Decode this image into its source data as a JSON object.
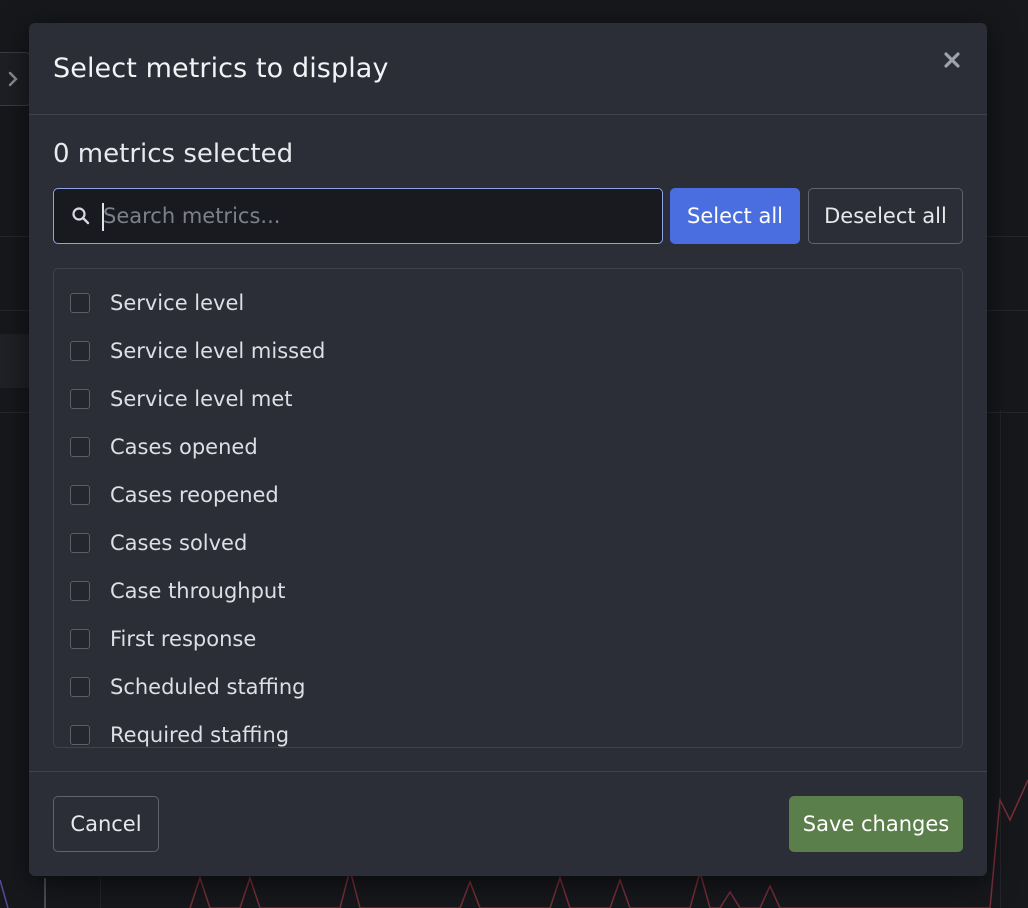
{
  "modal": {
    "title": "Select metrics to display",
    "close_icon": "close-icon",
    "selected_count_label": "0 metrics selected",
    "search": {
      "placeholder": "Search metrics...",
      "value": "",
      "icon": "search-icon"
    },
    "select_all_label": "Select all",
    "deselect_all_label": "Deselect all",
    "metrics": [
      {
        "label": "Service level",
        "checked": false
      },
      {
        "label": "Service level missed",
        "checked": false
      },
      {
        "label": "Service level met",
        "checked": false
      },
      {
        "label": "Cases opened",
        "checked": false
      },
      {
        "label": "Cases reopened",
        "checked": false
      },
      {
        "label": "Cases solved",
        "checked": false
      },
      {
        "label": "Case throughput",
        "checked": false
      },
      {
        "label": "First response",
        "checked": false
      },
      {
        "label": "Scheduled staffing",
        "checked": false
      },
      {
        "label": "Required staffing",
        "checked": false
      }
    ],
    "cancel_label": "Cancel",
    "save_label": "Save changes"
  },
  "colors": {
    "primary": "#4a6ee0",
    "save": "#5a7f4b",
    "modal_bg": "#2b2e36"
  }
}
